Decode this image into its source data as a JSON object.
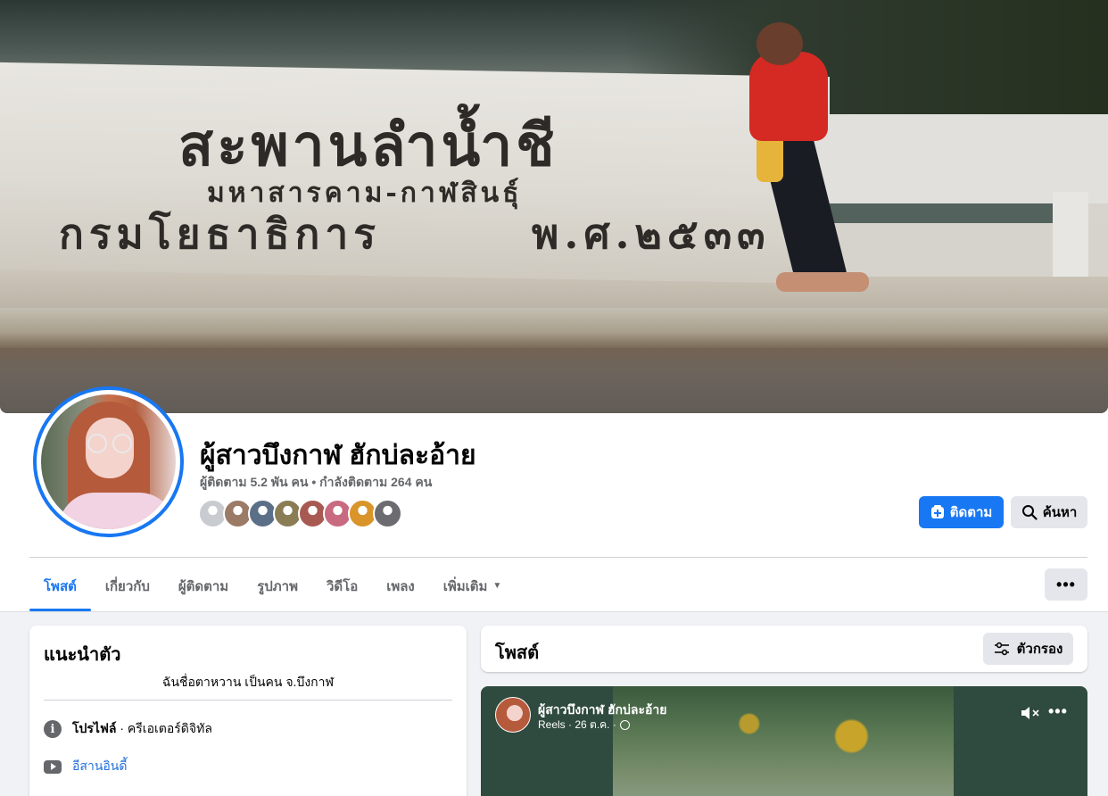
{
  "cover": {
    "sign_line1": "สะพานลำน้ำชี",
    "sign_line2": "มหาสารคาม-กาฬสินธุ์",
    "sign_line3": "กรมโยธาธิการ",
    "sign_line4": "พ.ศ.๒๕๓๓"
  },
  "profile": {
    "name": "ผู้สาวบึงกาฬ ฮักบ่ละอ้าย",
    "followers_text": "ผู้ติดตาม 5.2 พัน คน • กำลังติดตาม 264 คน",
    "mutual_colors": [
      "#c8cbd0",
      "#9b7a66",
      "#5b6f88",
      "#8a7d55",
      "#a85a52",
      "#c86a80",
      "#d9942a",
      "#6b6b70"
    ]
  },
  "actions": {
    "follow_label": "ติดตาม",
    "search_label": "ค้นหา",
    "accent": "#1877f2"
  },
  "tabs": [
    {
      "label": "โพสต์",
      "active": true
    },
    {
      "label": "เกี่ยวกับ",
      "active": false
    },
    {
      "label": "ผู้ติดตาม",
      "active": false
    },
    {
      "label": "รูปภาพ",
      "active": false
    },
    {
      "label": "วิดีโอ",
      "active": false
    },
    {
      "label": "เพลง",
      "active": false
    },
    {
      "label": "เพิ่มเติม",
      "active": false
    }
  ],
  "more_button": "•••",
  "intro": {
    "title": "แนะนำตัว",
    "bio": "ฉันชื่อตาหวาน เป็นคน จ.บึงกาฬ",
    "profile_label": "โปรไฟล์",
    "profile_category": " · ครีเอเตอร์ดิจิทัล",
    "link_text": "อีสานอินดี้"
  },
  "posts": {
    "title": "โพสต์",
    "filter_label": "ตัวกรอง"
  },
  "reel": {
    "author": "ผู้สาวบึงกาฬ ฮักบ่ละอ้าย",
    "meta": "Reels · 26 ต.ค. ·",
    "more": "•••"
  }
}
